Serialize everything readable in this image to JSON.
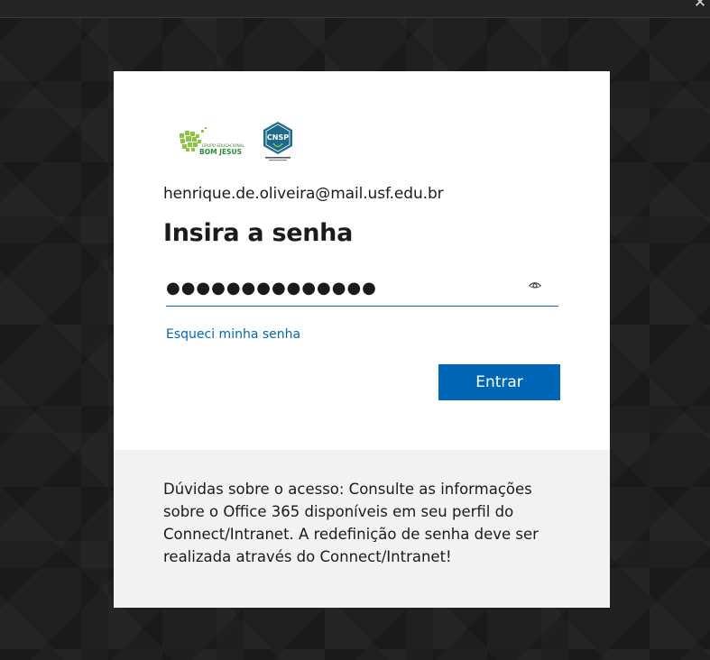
{
  "colors": {
    "accent": "#0067b8",
    "backdrop": "#1f2020",
    "dialog_bg": "#ffffff",
    "footer_bg": "#f2f2f2",
    "text": "#1b1b1b"
  },
  "window": {
    "close_glyph": "✕"
  },
  "logos": {
    "bom_jesus": {
      "line1": "GRUPO EDUCACIONAL",
      "line2": "BOM JESUS",
      "icon": "bom-jesus-logo-icon"
    },
    "cnsp": {
      "text": "CNSP",
      "icon": "cnsp-logo-icon"
    }
  },
  "signin": {
    "email": "henrique.de.oliveira@mail.usf.edu.br",
    "title": "Insira a senha",
    "password_mask": "●●●●●●●●●●●●●●",
    "reveal_icon": "eye-icon",
    "forgot_link": "Esqueci minha senha",
    "submit_label": "Entrar"
  },
  "footer": {
    "text": "Dúvidas sobre o acesso: Consulte as informações sobre o Office 365 disponíveis em seu perfil do Connect/Intranet. A redefinição de senha deve ser realizada através do Connect/Intranet!"
  }
}
